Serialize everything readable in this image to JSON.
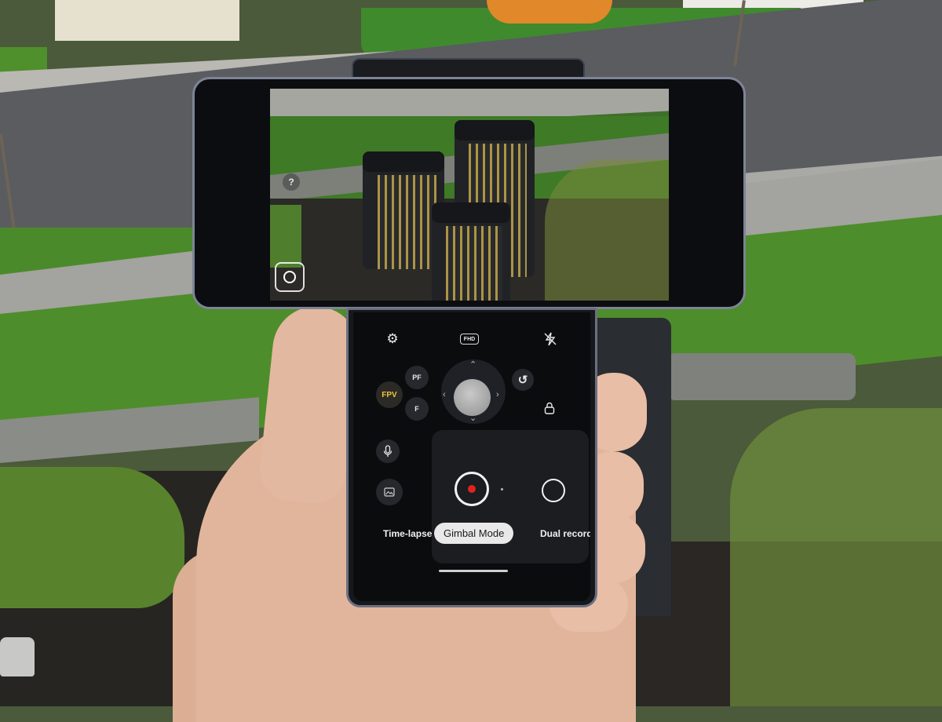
{
  "camera_viewfinder": {
    "help_glyph": "?",
    "track_icon": "target-track-icon"
  },
  "gimbal_panel": {
    "top_bar": {
      "settings_icon": "gear-icon",
      "resolution_badge": "FHD",
      "flash_icon": "flash-off-icon"
    },
    "controls": {
      "fpv_label": "FPV",
      "pf_label": "PF",
      "f_label": "F",
      "joystick_icon": "joystick-icon",
      "reset_icon": "rotate-reset-icon",
      "lock_icon": "lock-icon",
      "mic_icon": "microphone-icon",
      "gallery_icon": "gallery-icon"
    },
    "modes": [
      {
        "label": "Time-lapse",
        "selected": false
      },
      {
        "label": "Gimbal Mode",
        "selected": true
      },
      {
        "label": "Dual recording",
        "selected": false
      }
    ],
    "accent_colors": {
      "fpv": "#f0c43c",
      "record": "#e0231c"
    }
  }
}
